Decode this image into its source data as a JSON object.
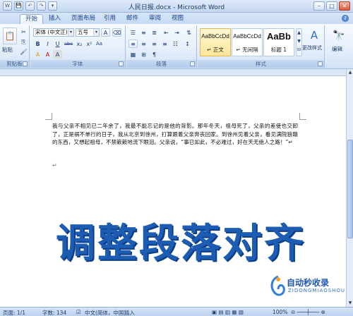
{
  "window": {
    "title": "人民日报.docx - Microsoft Word",
    "minimize": "–",
    "maximize": "□",
    "close": "✕"
  },
  "qat": [
    "W",
    "💾",
    "↶",
    "↷",
    "▾"
  ],
  "tabs": [
    "开始",
    "插入",
    "页面布局",
    "引用",
    "邮件",
    "审阅",
    "视图"
  ],
  "help": "?",
  "ribbon": {
    "clipboard": {
      "label": "剪贴板",
      "paste": "粘贴"
    },
    "font": {
      "label": "字体",
      "font_name": "宋体 (中文正)",
      "font_size": "五号",
      "buttons": [
        "B",
        "I",
        "U",
        "abe",
        "x₂",
        "x²",
        "Aa",
        "A",
        "A",
        "A"
      ]
    },
    "paragraph": {
      "label": "段落"
    },
    "styles": {
      "label": "样式",
      "items": [
        {
          "sample": "AaBbCcDd",
          "name": "↵ 正文"
        },
        {
          "sample": "AaBbCcDd",
          "name": "↵ 无间隔"
        },
        {
          "sample": "AaBb",
          "name": "标题 1"
        }
      ],
      "change_styles": "更改样式",
      "editing": "编辑"
    }
  },
  "document": {
    "paragraph": "我与父亲不相见已二年余了，我最不能忘记的是他的背影。那年冬天，祖母死了，父亲的差使也交卸了，正是祸不单行的日子，我从北京到徐州，打算跟着父亲奔丧回家。到徐州见着父亲，看见满院狼藉的东西，又想起祖母，不禁簌簌地流下眼泪。父亲说，“事已如此，不必难过，好在天无绝人之路！”↵",
    "paragraph_mark": "↵"
  },
  "overlay": {
    "title": "调整段落对齐",
    "logo_text": "自动秒收录",
    "logo_sub": "ZIDONGMIAOSHOU"
  },
  "status": {
    "page": "页面: 1/1",
    "words": "字数: 134",
    "lang": "中文(简体，中国)",
    "mode": "插入",
    "zoom": "100%"
  },
  "colors": {
    "accent": "#1c5db3",
    "ribbon": "#dbe8f8"
  }
}
